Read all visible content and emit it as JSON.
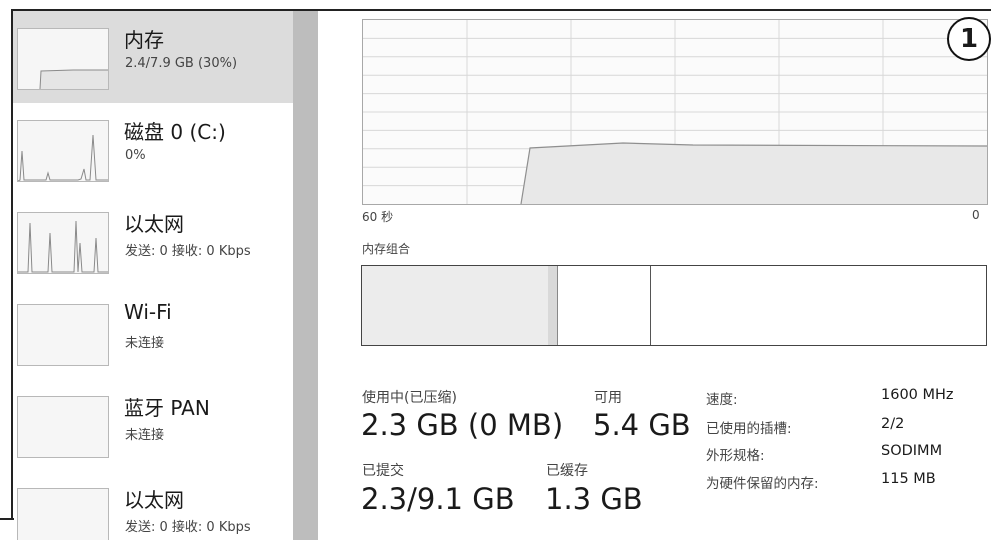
{
  "sidebar": {
    "items": [
      {
        "title": "内存",
        "subtitle": "2.4/7.9 GB (30%)"
      },
      {
        "title": "磁盘 0 (C:)",
        "subtitle": "0%"
      },
      {
        "title": "以太网",
        "subtitle": "发送: 0 接收: 0 Kbps"
      },
      {
        "title": "Wi-Fi",
        "subtitle": "未连接"
      },
      {
        "title": "蓝牙 PAN",
        "subtitle": "未连接"
      },
      {
        "title": "以太网",
        "subtitle": "发送: 0 接收: 0 Kbps"
      }
    ]
  },
  "graph": {
    "left_axis": "60 秒",
    "right_axis": "0",
    "composition_label": "内存组合",
    "composition_fractions": {
      "in_use": 0.3,
      "modified": 0.01,
      "standby": 0.15,
      "free": 0.54
    }
  },
  "callout": "1",
  "stats": {
    "in_use_label": "使用中(已压缩)",
    "in_use_value": "2.3 GB (0 MB)",
    "available_label": "可用",
    "available_value": "5.4 GB",
    "committed_label": "已提交",
    "committed_value": "2.3/9.1 GB",
    "cached_label": "已缓存",
    "cached_value": "1.3 GB"
  },
  "properties": [
    {
      "label": "速度:",
      "value": "1600 MHz"
    },
    {
      "label": "已使用的插槽:",
      "value": "2/2"
    },
    {
      "label": "外形规格:",
      "value": "SODIMM"
    },
    {
      "label": "为硬件保留的内存:",
      "value": "115 MB"
    }
  ],
  "colors": {
    "selected_bg": "#dcdcdc",
    "graph_line": "#8f8f8f",
    "graph_fill": "#e8e8e8"
  }
}
